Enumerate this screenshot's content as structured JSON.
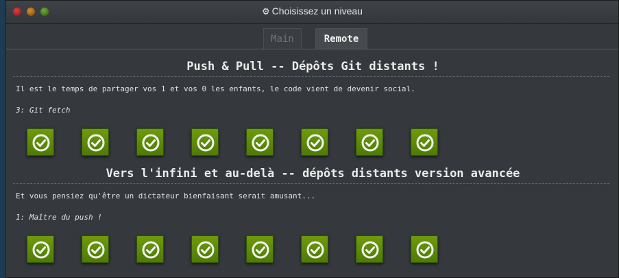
{
  "window": {
    "title": "Choisissez un niveau",
    "title_icon": "gear-icon",
    "buttons": [
      "close",
      "minimize",
      "maximize"
    ]
  },
  "tabs": [
    {
      "label": "Main",
      "active": false
    },
    {
      "label": "Remote",
      "active": true
    }
  ],
  "sections": [
    {
      "title": "Push & Pull -- Dépôts Git distants !",
      "description": "Il est le temps de partager vos 1 et vos 0 les enfants, le code vient de devenir social.",
      "current_level": "3: Git fetch",
      "levels_completed": 8,
      "level_icon": "checkmark-icon"
    },
    {
      "title": "Vers l'infini et au-delà -- dépôts distants version avancée",
      "description": "Et vous pensiez qu'être un dictateur bienfaisant serait amusant...",
      "current_level": "1: Maître du push !",
      "levels_completed": 8,
      "level_icon": "checkmark-icon"
    }
  ],
  "colors": {
    "level_complete": "#5f8c07",
    "background": "#35393d",
    "desktop": "#1d3b52"
  }
}
